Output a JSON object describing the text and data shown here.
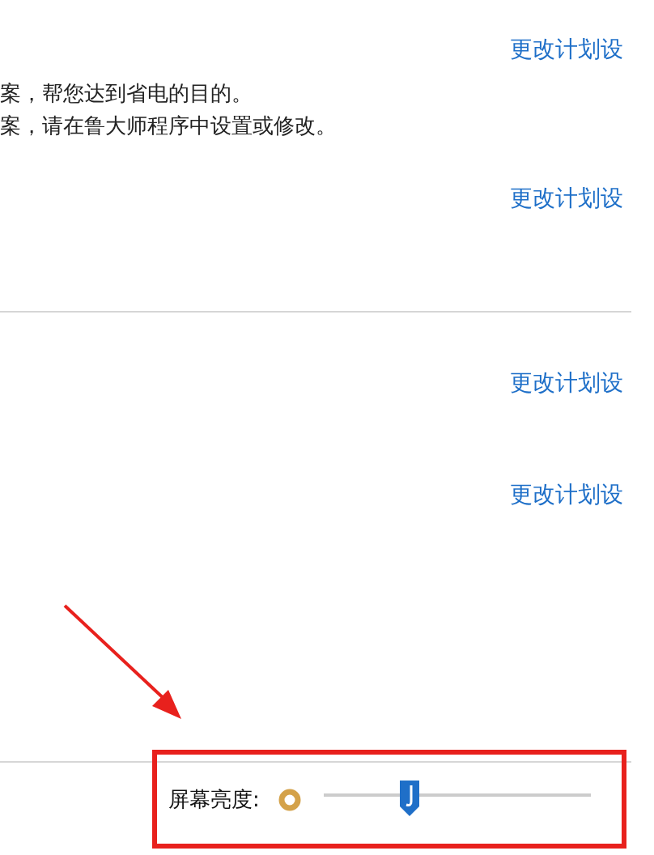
{
  "plans": [
    {
      "link": "更改计划设",
      "description": [
        "案，帮您达到省电的目的。",
        "案，请在鲁大师程序中设置或修改。"
      ]
    },
    {
      "link": "更改计划设"
    },
    {
      "link": "更改计划设"
    },
    {
      "link": "更改计划设"
    }
  ],
  "brightness": {
    "label": "屏幕亮度:",
    "level": 0.32
  }
}
